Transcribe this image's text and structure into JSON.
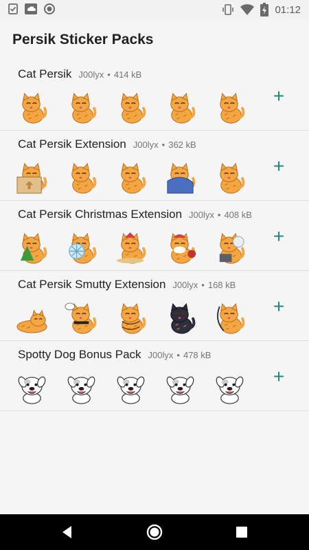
{
  "status_bar": {
    "time": "01:12",
    "left_icons": [
      "checklist-icon",
      "cloud-app-icon",
      "circle-app-icon"
    ],
    "right_icons": [
      "vibrate-icon",
      "wifi-icon",
      "battery-icon"
    ]
  },
  "app_bar": {
    "title": "Persik Sticker Packs"
  },
  "packs": [
    {
      "name": "Cat Persik",
      "author": "J00lyx",
      "separator": "•",
      "size": "414 kB",
      "style": "cat",
      "stickers": [
        "cat-sticker-1",
        "cat-sticker-2",
        "cat-sticker-3",
        "cat-sticker-4",
        "cat-sticker-5"
      ]
    },
    {
      "name": "Cat Persik Extension",
      "author": "J00lyx",
      "separator": "•",
      "size": "362 kB",
      "style": "cat",
      "stickers": [
        "cat-in-box-sticker",
        "cat-sticker-6",
        "cat-sticker-7",
        "cat-blanket-sticker",
        "cat-sticker-8"
      ]
    },
    {
      "name": "Cat Persik Christmas Extension",
      "author": "J00lyx",
      "separator": "•",
      "size": "408 kB",
      "style": "cat",
      "stickers": [
        "cat-tree-sticker",
        "cat-snowflake-sticker",
        "cat-gift-sticker",
        "cat-santa-sticker",
        "cat-snowman-sticker"
      ]
    },
    {
      "name": "Cat Persik Smutty Extension",
      "author": "J00lyx",
      "separator": "•",
      "size": "168 kB",
      "style": "cat",
      "stickers": [
        "cat-lying-sticker",
        "cat-thought-sticker",
        "cat-tied-sticker",
        "cat-dark-sticker",
        "cat-whip-sticker"
      ]
    },
    {
      "name": "Spotty Dog Bonus Pack",
      "author": "J00lyx",
      "separator": "•",
      "size": "478 kB",
      "style": "dog",
      "stickers": [
        "dog-sticker-1",
        "dog-sticker-2",
        "dog-sticker-3",
        "dog-sticker-4",
        "dog-sticker-5"
      ]
    }
  ],
  "add_button": {
    "label": "+"
  },
  "colors": {
    "accent": "#1a8a78",
    "cat_orange": "#f3a641",
    "background": "#f5f5f5"
  },
  "nav_bar": {
    "icons": [
      "back-triangle-icon",
      "home-circle-icon",
      "recents-square-icon"
    ]
  }
}
